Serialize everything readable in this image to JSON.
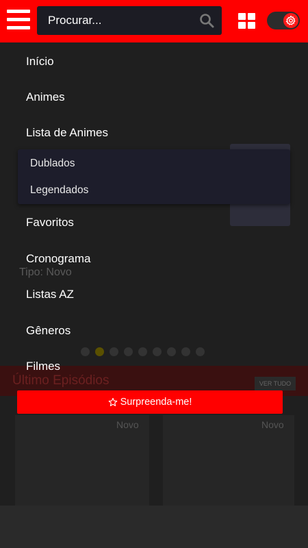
{
  "header": {
    "search_placeholder": "Procurar...",
    "brand_color": "#ff0000"
  },
  "menu": {
    "items": [
      {
        "label": "Início"
      },
      {
        "label": "Animes"
      },
      {
        "label": "Lista de Animes"
      },
      {
        "label": "Favoritos"
      },
      {
        "label": "Cronograma"
      },
      {
        "label": "Listas AZ"
      },
      {
        "label": "Gêneros"
      },
      {
        "label": "Filmes"
      }
    ],
    "submenu": [
      {
        "label": "Dublados"
      },
      {
        "label": "Legendados"
      }
    ],
    "surprise_button": "Surpreenda-me!"
  },
  "background": {
    "type_label": "Tipo: Novo",
    "section_title": "Último Episódios",
    "see_all": "VER TUDO",
    "episode_badges": [
      "Novo",
      "Novo"
    ]
  }
}
